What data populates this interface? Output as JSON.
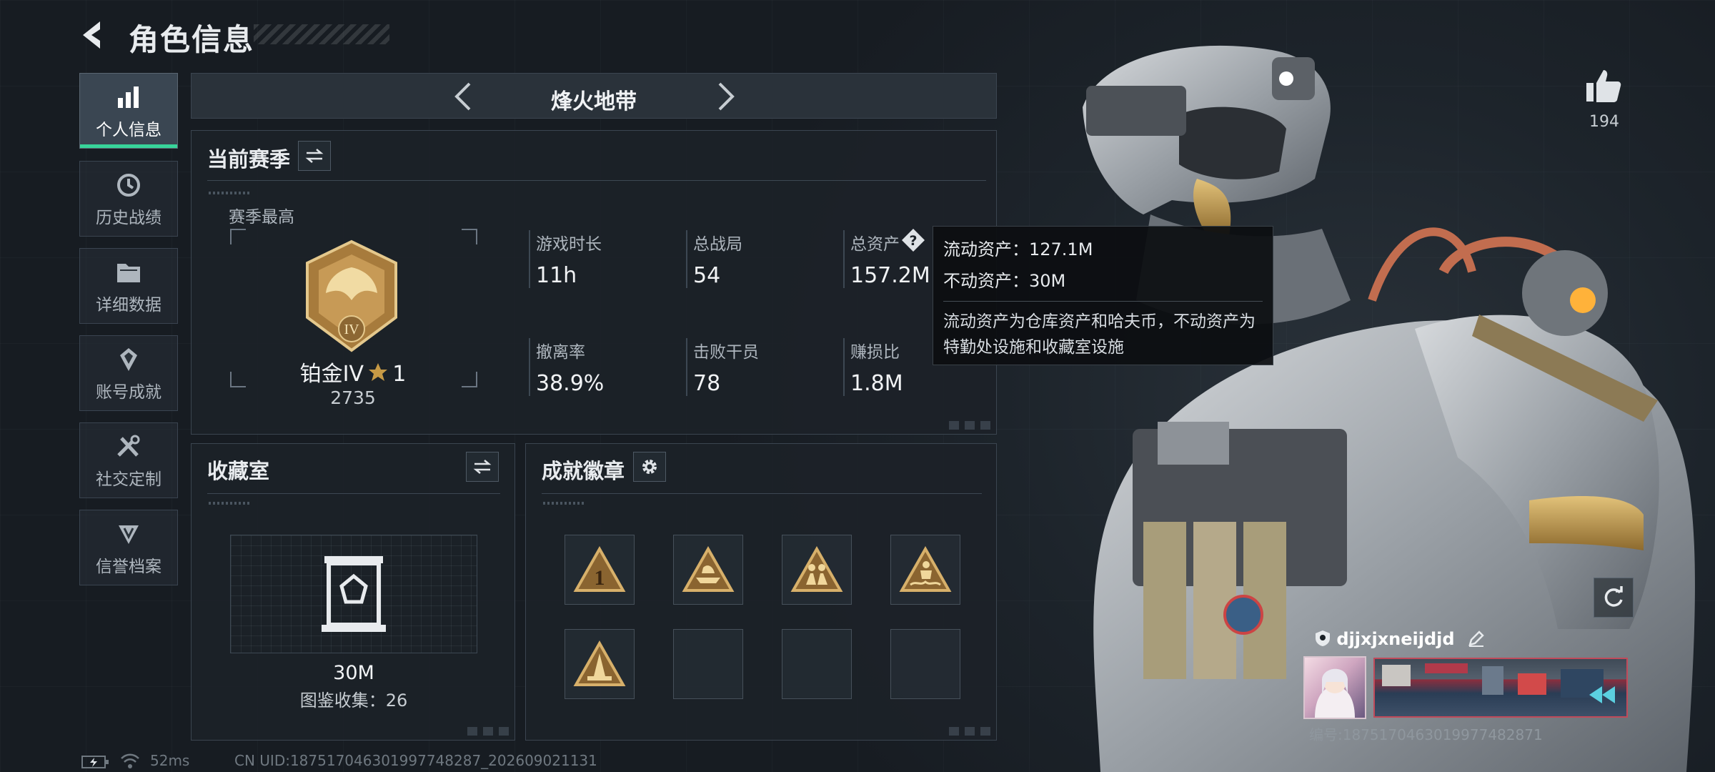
{
  "header": {
    "title": "角色信息"
  },
  "sidebar": {
    "items": [
      {
        "label": "个人信息",
        "icon": "bar-chart-icon",
        "active": true
      },
      {
        "label": "历史战绩",
        "icon": "history-icon"
      },
      {
        "label": "详细数据",
        "icon": "folder-icon"
      },
      {
        "label": "账号成就",
        "icon": "achievement-icon"
      },
      {
        "label": "社交定制",
        "icon": "tools-icon"
      },
      {
        "label": "信誉档案",
        "icon": "credit-icon"
      }
    ]
  },
  "mode": {
    "name": "烽火地带"
  },
  "season": {
    "title": "当前赛季",
    "best_label": "赛季最高",
    "rank": {
      "name": "铂金IV",
      "stars": "1",
      "emblem_numeral": "IV",
      "score": "2735"
    },
    "stats": [
      {
        "key": "游戏时长",
        "value": "11h"
      },
      {
        "key": "总战局",
        "value": "54"
      },
      {
        "key": "总资产",
        "value": "157.2M"
      },
      {
        "key": "撤离率",
        "value": "38.9%"
      },
      {
        "key": "击败干员",
        "value": "78"
      },
      {
        "key": "赚损比",
        "value": "1.8M"
      }
    ]
  },
  "tooltip": {
    "liquid": "流动资产：127.1M",
    "fixed": "不动资产：30M",
    "note": "流动资产为仓库资产和哈夫币，不动资产为特勤处设施和收藏室设施"
  },
  "collection": {
    "title": "收藏室",
    "value": "30M",
    "codex": "图鉴收集：26"
  },
  "badges": {
    "title": "成就徽章",
    "slots": [
      {
        "filled": true,
        "glyph": "1"
      },
      {
        "filled": true,
        "glyph": "ship"
      },
      {
        "filled": true,
        "glyph": "squad"
      },
      {
        "filled": true,
        "glyph": "wave"
      },
      {
        "filled": true,
        "glyph": "tower"
      },
      {
        "filled": false
      },
      {
        "filled": false
      },
      {
        "filled": false
      }
    ]
  },
  "profile": {
    "likes": "194",
    "username": "djjxjxneijdjd",
    "number": "编号:1875170463019977482871"
  },
  "status": {
    "ping": "52ms",
    "uid": "CN UID:18751704630199774828​7_202609021131"
  },
  "colors": {
    "accent": "#37d49a",
    "gold": "#c79a45",
    "panel": "#1c2228"
  }
}
